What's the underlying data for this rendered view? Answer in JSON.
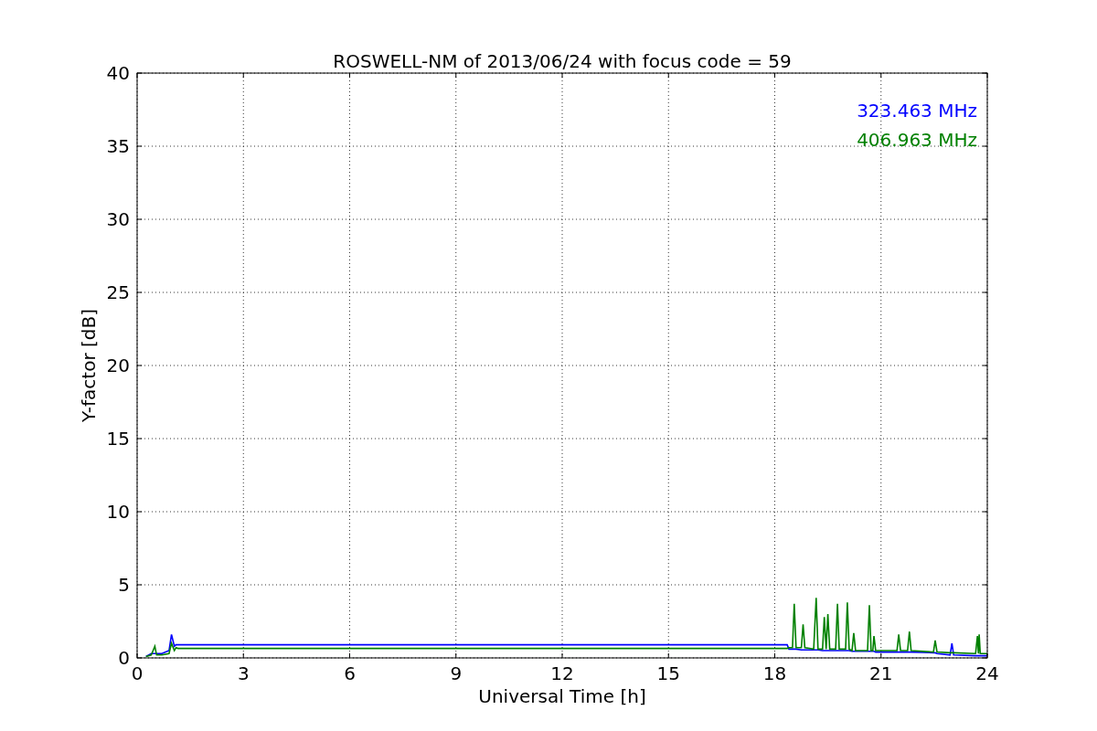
{
  "chart": {
    "chart_data": {
      "type": "line",
      "title": "ROSWELL-NM of 2013/06/24 with focus code = 59",
      "xlabel": "Universal Time [h]",
      "ylabel": "Y-factor [dB]",
      "x": [
        0.25,
        0.4,
        0.5,
        0.55,
        0.7,
        0.9,
        0.97,
        1.05,
        1.1,
        1.15,
        18.35,
        18.4,
        18.5,
        18.55,
        18.6,
        18.75,
        18.8,
        18.85,
        19.1,
        19.17,
        19.22,
        19.35,
        19.4,
        19.45,
        19.5,
        19.55,
        19.72,
        19.77,
        19.82,
        20.0,
        20.05,
        20.1,
        20.18,
        20.23,
        20.28,
        20.62,
        20.67,
        20.72,
        20.77,
        20.8,
        20.85,
        21.45,
        21.5,
        21.55,
        21.75,
        21.8,
        21.85,
        22.48,
        22.53,
        22.58,
        22.95,
        23.0,
        23.05,
        23.67,
        23.72,
        23.75,
        23.77,
        23.8,
        24.0
      ],
      "series": [
        {
          "name": "323.463 MHz",
          "color": "#0000ff",
          "values": [
            0.1,
            0.3,
            0.3,
            0.3,
            0.3,
            0.5,
            1.6,
            0.8,
            0.9,
            0.9,
            0.9,
            0.6,
            0.6,
            0.6,
            0.6,
            0.55,
            0.55,
            0.55,
            0.55,
            0.55,
            0.55,
            0.5,
            0.5,
            0.5,
            0.5,
            0.5,
            0.5,
            0.5,
            0.5,
            0.5,
            0.5,
            0.5,
            0.45,
            0.45,
            0.45,
            0.45,
            0.45,
            0.45,
            0.45,
            0.45,
            0.4,
            0.4,
            0.4,
            0.4,
            0.4,
            0.4,
            0.4,
            0.35,
            0.35,
            0.3,
            0.2,
            1.0,
            0.2,
            0.15,
            0.15,
            0.15,
            0.15,
            0.15,
            0.15
          ]
        },
        {
          "name": "406.963 MHz",
          "color": "#008000",
          "values": [
            0.1,
            0.2,
            0.8,
            0.2,
            0.2,
            0.3,
            1.0,
            0.5,
            0.7,
            0.65,
            0.65,
            0.7,
            0.7,
            3.7,
            0.7,
            0.7,
            2.3,
            0.7,
            0.6,
            4.1,
            0.6,
            0.6,
            2.8,
            0.6,
            3.0,
            0.6,
            0.6,
            3.7,
            0.6,
            0.6,
            3.8,
            0.6,
            0.5,
            1.7,
            0.5,
            0.5,
            3.6,
            0.5,
            0.5,
            1.5,
            0.5,
            0.5,
            1.6,
            0.5,
            0.5,
            1.8,
            0.5,
            0.4,
            1.2,
            0.4,
            0.35,
            0.35,
            0.35,
            0.3,
            1.5,
            0.3,
            1.6,
            0.3,
            0.3
          ]
        }
      ],
      "grid": true,
      "xlim": [
        0,
        24
      ],
      "ylim": [
        0,
        40
      ],
      "xticks": [
        0,
        3,
        6,
        9,
        12,
        15,
        18,
        21,
        24
      ],
      "yticks": [
        0,
        5,
        10,
        15,
        20,
        25,
        30,
        35,
        40
      ]
    }
  }
}
